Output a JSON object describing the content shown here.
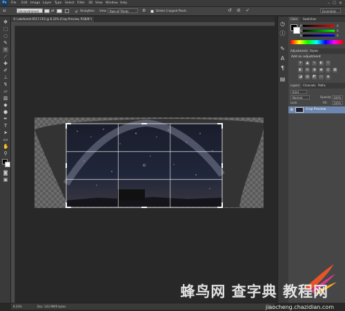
{
  "app": {
    "logo": "Ps"
  },
  "menu": [
    "File",
    "Edit",
    "Image",
    "Layer",
    "Type",
    "Select",
    "Filter",
    "3D",
    "View",
    "Window",
    "Help"
  ],
  "options_bar": {
    "ratio_select": "Unconstrained",
    "straighten_label": "Straighten",
    "view_label": "View:",
    "view_select": "Rule of Thirds",
    "delete_cropped_label": "Delete Cropped Pixels",
    "workspace": "Essentials"
  },
  "document": {
    "tab_title": "© Lakeforest-9517.CR2 @ 8.33% (Crop Preview, RGB/8*)",
    "zoom": "8.33%",
    "doc_size": "Doc: 143.9M/0 bytes"
  },
  "panels": {
    "color_tabs": [
      "Color",
      "Swatches"
    ],
    "sliders": [
      {
        "label": "R",
        "value": "0"
      },
      {
        "label": "G",
        "value": "0"
      },
      {
        "label": "B",
        "value": "0"
      }
    ],
    "adjustments_tabs": [
      "Adjustments",
      "Styles"
    ],
    "adjustments_title": "Add an adjustment",
    "layers_tabs": [
      "Layers",
      "Channels",
      "Paths"
    ],
    "layer_kind": "Kind",
    "blend_mode": "Normal",
    "opacity_label": "Opacity:",
    "opacity_value": "100%",
    "lock_label": "Lock:",
    "fill_label": "Fill:",
    "fill_value": "100%",
    "layer_name": "Crop Preview"
  },
  "watermark": {
    "cn": "蜂鸟网 查字典 教程网",
    "url": "jiaocheng.chazidian.com"
  },
  "colors": {
    "accent": "#6d87b0",
    "crop_handle": "#ffffff",
    "guide": "#e6e6e6",
    "checker_dark": "#5a5a5a",
    "checker_light": "#6c6c6c"
  }
}
